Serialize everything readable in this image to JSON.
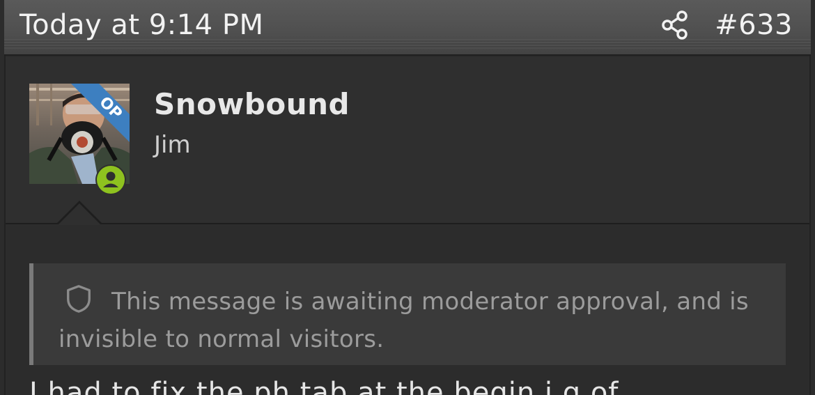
{
  "header": {
    "timestamp": "Today at 9:14 PM",
    "post_number": "#633",
    "share_icon": "share-icon"
  },
  "user": {
    "name": "Snowbound",
    "title": "Jim",
    "op_badge": "OP",
    "online_icon": "user-online-icon",
    "online_color": "#8ec21f",
    "op_ribbon_color": "#3d7fc0"
  },
  "notice": {
    "icon": "shield-icon",
    "text": "This message is awaiting moderator approval, and is invisible to normal visitors."
  },
  "body": {
    "text": "I had to fix the ph tab at the begin i g of"
  }
}
